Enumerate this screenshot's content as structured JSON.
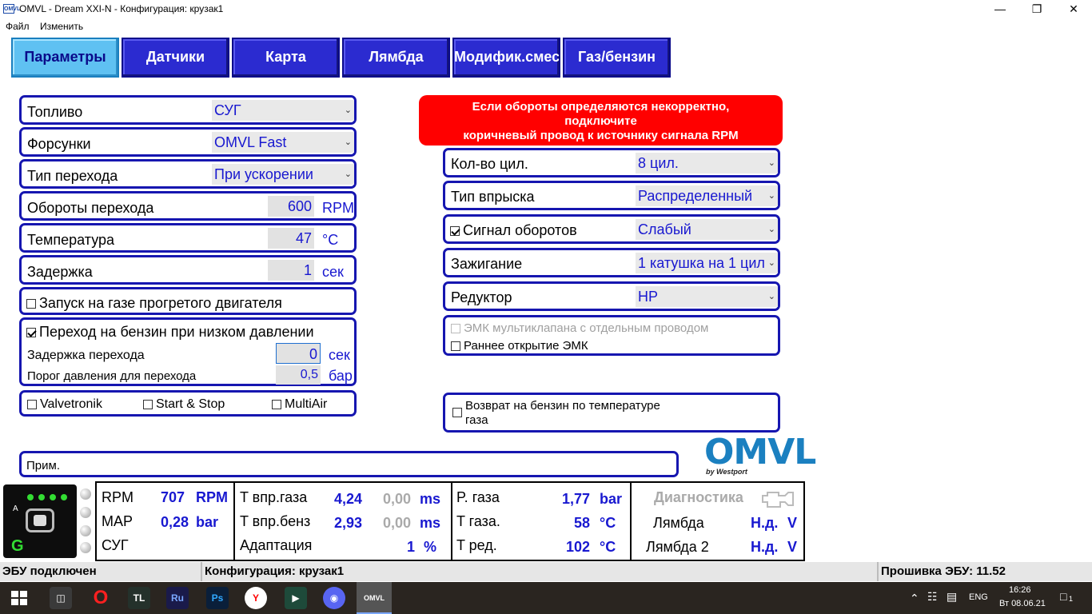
{
  "window": {
    "app_icon": "OMVL",
    "title": "OMVL - Dream XXI-N - Конфигурация: крузак1",
    "controls": [
      "minimize-icon",
      "maximize-icon",
      "close-icon"
    ]
  },
  "menu": [
    "Файл",
    "Изменить"
  ],
  "tabs": [
    "Параметры",
    "Датчики",
    "Карта",
    "Лямбда",
    "Модифик.смеси",
    "Газ/бензин"
  ],
  "left": {
    "fuel": {
      "label": "Топливо",
      "value": "СУГ"
    },
    "injectors": {
      "label": "Форсунки",
      "value": "OMVL Fast"
    },
    "switch_type": {
      "label": "Тип перехода",
      "value": "При ускорении"
    },
    "switch_rpm": {
      "label": "Обороты перехода",
      "value": "600",
      "unit": "RPM"
    },
    "temperature": {
      "label": "Температура",
      "value": "47",
      "unit": "°C"
    },
    "delay": {
      "label": "Задержка",
      "value": "1",
      "unit": "сек"
    },
    "warm_start": {
      "label": "Запуск на газе прогретого двигателя",
      "checked": false
    },
    "low_pressure": {
      "label": "Переход на бензин при низком давлении",
      "checked": true,
      "delay_label": "Задержка перехода",
      "delay_value": "0",
      "delay_unit": "сек",
      "threshold_label": "Порог давления для перехода",
      "threshold_value": "0,5",
      "threshold_unit": "бар"
    },
    "options": [
      {
        "label": "Valvetronik",
        "checked": false
      },
      {
        "label": "Start & Stop",
        "checked": false
      },
      {
        "label": "MultiAir",
        "checked": false
      }
    ],
    "note_label": "Прим."
  },
  "warning": {
    "line1": "Если обороты определяются некорректно,",
    "line2": "подключите",
    "line3": "коричневый провод к источнику сигнала RPM"
  },
  "right": {
    "cylinders": {
      "label": "Кол-во цил.",
      "value": "8 цил."
    },
    "injection": {
      "label": "Тип впрыска",
      "value": "Распределенный"
    },
    "rpm_signal": {
      "label": "Сигнал оборотов",
      "checked": true,
      "value": "Слабый"
    },
    "ignition": {
      "label": "Зажигание",
      "value": "1 катушка на 1 цил"
    },
    "reducer": {
      "label": "Редуктор",
      "value": "HP"
    },
    "emk_multi": {
      "label": "ЭМК мультиклапана с отдельным проводом",
      "checked": false,
      "disabled": true
    },
    "emk_early": {
      "label": "Раннее открытие ЭМК",
      "checked": false
    },
    "temp_return": {
      "label1": "Возврат на бензин по температуре",
      "label2": "газа",
      "checked": false
    }
  },
  "logo": {
    "brand": "OMVL",
    "sub": "by Westport"
  },
  "status_panel": {
    "indicator_label": "G",
    "indicator_a": "A",
    "col1": {
      "rpm_label": "RPM",
      "rpm_value": "707",
      "rpm_unit": "RPM",
      "map_label": "MAP",
      "map_value": "0,28",
      "map_unit": "bar",
      "fuel_label": "СУГ"
    },
    "col2": {
      "tgas_label": "T впр.газа",
      "tgas_value": "4,24",
      "tgas_value2": "0,00",
      "tgas_unit": "ms",
      "tpet_label": "T впр.бенз",
      "tpet_value": "2,93",
      "tpet_value2": "0,00",
      "tpet_unit": "ms",
      "adapt_label": "Адаптация",
      "adapt_value": "1",
      "adapt_unit": "%"
    },
    "col3": {
      "pgas_label": "P. газа",
      "pgas_value": "1,77",
      "pgas_unit": "bar",
      "tgasc_label": "T газа.",
      "tgasc_value": "58",
      "tgasc_unit": "°C",
      "tred_label": "T ред.",
      "tred_value": "102",
      "tred_unit": "°C"
    },
    "col4": {
      "diag_label": "Диагностика",
      "lambda_label": "Лямбда",
      "lambda_value": "Н.д.",
      "lambda_unit": "V",
      "lambda2_label": "Лямбда 2",
      "lambda2_value": "Н.д.",
      "lambda2_unit": "V"
    }
  },
  "statusbar": {
    "connection": "ЭБУ подключен",
    "config": "Конфигурация: крузак1",
    "firmware": "Прошивка ЭБУ: 11.52"
  },
  "taskbar": {
    "apps": [
      "TL",
      "Ru",
      "Ps",
      "Y",
      "OMVL"
    ],
    "lang": "ENG",
    "time": "16:26",
    "date": "Вт 08.06.21",
    "notif_count": "1"
  }
}
